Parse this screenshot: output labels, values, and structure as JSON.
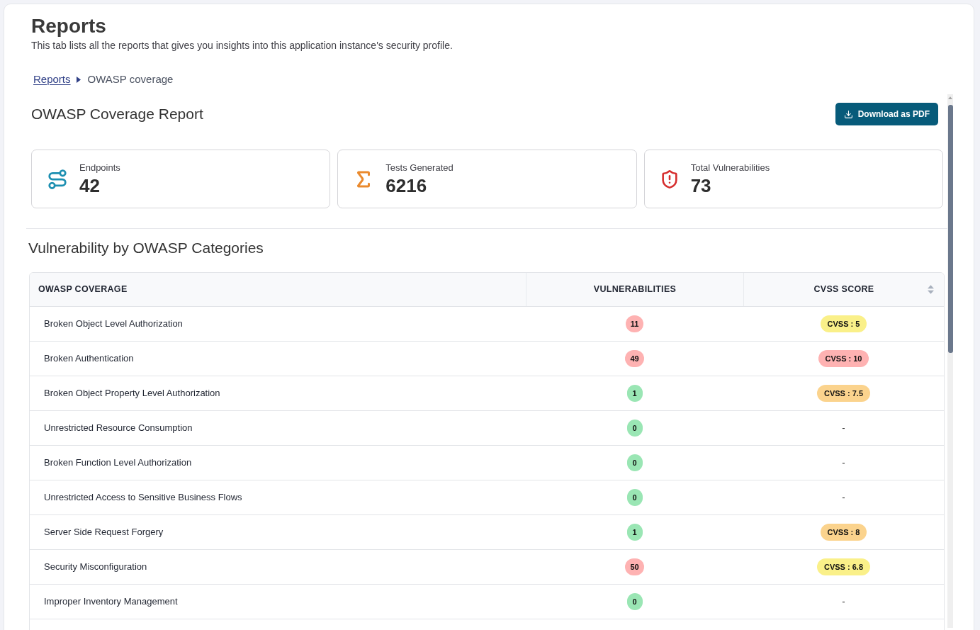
{
  "page": {
    "title": "Reports",
    "subtitle": "This tab lists all the reports that gives you insights into this application instance's security profile."
  },
  "breadcrumb": [
    {
      "label": "Reports",
      "kind": "link"
    },
    {
      "label": "OWASP coverage",
      "kind": "current"
    }
  ],
  "report": {
    "title": "OWASP Coverage Report",
    "download_button": "Download as PDF"
  },
  "stats": [
    {
      "label": "Endpoints",
      "value": "42"
    },
    {
      "label": "Tests Generated",
      "value": "6216"
    },
    {
      "label": "Total Vulnerabilities",
      "value": "73"
    }
  ],
  "section_title": "Vulnerability by OWASP Categories",
  "table": {
    "columns": [
      {
        "label": "OWASP COVERAGE",
        "sortable": false
      },
      {
        "label": "VULNERABILITIES",
        "sortable": false
      },
      {
        "label": "CVSS SCORE",
        "sortable": true
      }
    ],
    "rows": [
      {
        "category": "Broken Object Level Authorization",
        "vulnerabilities": {
          "text": "11",
          "color": "#feb2b2"
        },
        "cvss": {
          "kind": "badge",
          "text": "CVSS : 5",
          "color": "#faf089"
        }
      },
      {
        "category": "Broken Authentication",
        "vulnerabilities": {
          "text": "49",
          "color": "#feb2b2"
        },
        "cvss": {
          "kind": "badge",
          "text": "CVSS : 10",
          "color": "#feb2b2"
        }
      },
      {
        "category": "Broken Object Property Level Authorization",
        "vulnerabilities": {
          "text": "1",
          "color": "#9ae6b4"
        },
        "cvss": {
          "kind": "badge",
          "text": "CVSS : 7.5",
          "color": "#fbd38d"
        }
      },
      {
        "category": "Unrestricted Resource Consumption",
        "vulnerabilities": {
          "text": "0",
          "color": "#9ae6b4"
        },
        "cvss": {
          "kind": "dash",
          "text": "-"
        }
      },
      {
        "category": "Broken Function Level Authorization",
        "vulnerabilities": {
          "text": "0",
          "color": "#9ae6b4"
        },
        "cvss": {
          "kind": "dash",
          "text": "-"
        }
      },
      {
        "category": "Unrestricted Access to Sensitive Business Flows",
        "vulnerabilities": {
          "text": "0",
          "color": "#9ae6b4"
        },
        "cvss": {
          "kind": "dash",
          "text": "-"
        }
      },
      {
        "category": "Server Side Request Forgery",
        "vulnerabilities": {
          "text": "1",
          "color": "#9ae6b4"
        },
        "cvss": {
          "kind": "badge",
          "text": "CVSS : 8",
          "color": "#fbd38d"
        }
      },
      {
        "category": "Security Misconfiguration",
        "vulnerabilities": {
          "text": "50",
          "color": "#feb2b2"
        },
        "cvss": {
          "kind": "badge",
          "text": "CVSS : 6.8",
          "color": "#faf089"
        }
      },
      {
        "category": "Improper Inventory Management",
        "vulnerabilities": {
          "text": "0",
          "color": "#9ae6b4"
        },
        "cvss": {
          "kind": "dash",
          "text": "-"
        }
      }
    ]
  }
}
